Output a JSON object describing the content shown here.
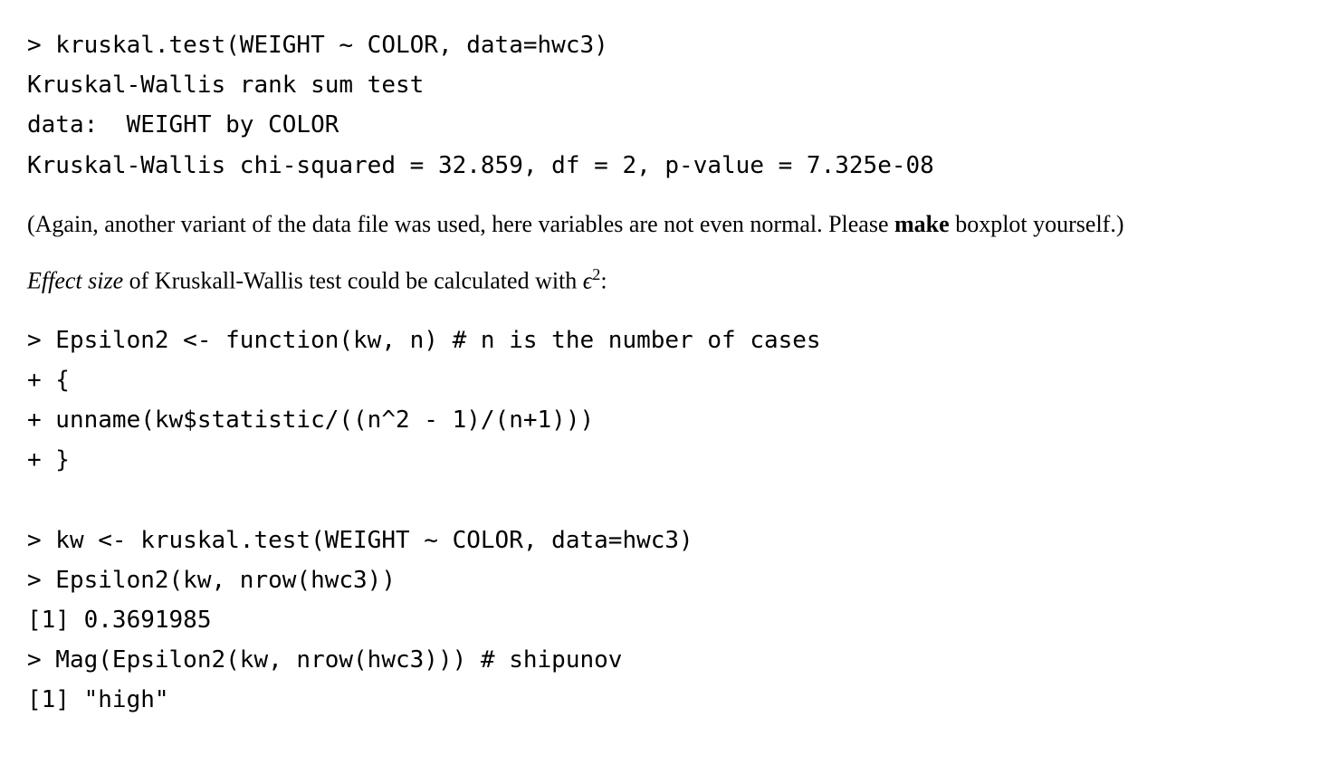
{
  "code1": {
    "l1": "> kruskal.test(WEIGHT ~ COLOR, data=hwc3)",
    "l2": "Kruskal-Wallis rank sum test",
    "l3": "data:  WEIGHT by COLOR",
    "l4": "Kruskal-Wallis chi-squared = 32.859, df = 2, p-value = 7.325e-08"
  },
  "para1": {
    "t1": "(Again, another variant of the data file was used, here variables are not even normal. Please ",
    "bold": "make",
    "t2": " boxplot yourself.)"
  },
  "para2": {
    "italic": "Effect size",
    "t1": " of Kruskall-Wallis test could be calculated with ",
    "eps": "ϵ",
    "sup": "2",
    "t2": ":"
  },
  "code2": {
    "l1": "> Epsilon2 <- function(kw, n) # n is the number of cases",
    "l2": "+ {",
    "l3": "+ unname(kw$statistic/((n^2 - 1)/(n+1)))",
    "l4": "+ }"
  },
  "code3": {
    "l1": "> kw <- kruskal.test(WEIGHT ~ COLOR, data=hwc3)",
    "l2": "> Epsilon2(kw, nrow(hwc3))",
    "l3": "[1] 0.3691985",
    "l4": "> Mag(Epsilon2(kw, nrow(hwc3))) # shipunov",
    "l5": "[1] \"high\""
  }
}
